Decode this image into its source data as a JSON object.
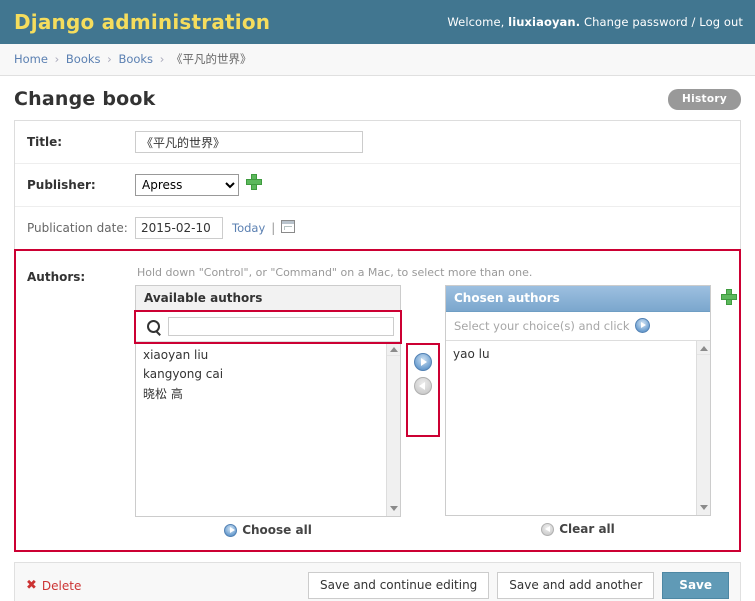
{
  "header": {
    "brand": "Django administration",
    "welcome_prefix": "Welcome,",
    "username": "liuxiaoyan.",
    "change_password": "Change password",
    "separator": "/",
    "logout": "Log out"
  },
  "breadcrumbs": {
    "items": [
      "Home",
      "Books",
      "Books"
    ],
    "current": "《平凡的世界》",
    "separator": "›"
  },
  "page": {
    "title": "Change book",
    "history_label": "History"
  },
  "form": {
    "title_label": "Title:",
    "title_value": "《平凡的世界》",
    "publisher_label": "Publisher:",
    "publisher_value": "Apress",
    "publisher_options": [
      "Apress"
    ],
    "add_publisher_icon": "add-plus-icon",
    "pubdate_label": "Publication date:",
    "pubdate_value": "2015-02-10",
    "today_label": "Today",
    "pipe": "|",
    "calendar_icon": "calendar-icon",
    "authors_label": "Authors:",
    "authors_help": "Hold down \"Control\", or \"Command\" on a Mac, to select more than one."
  },
  "selector": {
    "available_title": "Available authors",
    "search_icon": "search-icon",
    "search_value": "",
    "search_placeholder": "",
    "available_items": [
      "xiaoyan liu",
      "kangyong cai",
      "晓松 高"
    ],
    "choose_all_label": "Choose all",
    "chosen_title": "Chosen authors",
    "chosen_help": "Select your choice(s) and click",
    "chosen_help_icon": "arrow-right-circle-icon",
    "chosen_items": [
      "yao lu"
    ],
    "clear_all_label": "Clear all",
    "add_button_icon": "chooser-add-arrow-icon",
    "remove_button_icon": "chooser-remove-arrow-icon",
    "add_author_icon": "add-plus-icon"
  },
  "submit": {
    "delete_icon": "delete-x-icon",
    "delete_label": "Delete",
    "save_continue_label": "Save and continue editing",
    "save_add_another_label": "Save and add another",
    "save_label": "Save"
  },
  "colors": {
    "header_bg": "#417690",
    "brand_text": "#f5dd5d",
    "link_blue": "#5b80b2",
    "highlight_red": "#cc0033",
    "save_button": "#609ab6",
    "delete_red": "#cc3333",
    "chosen_header": "#7ba7cd",
    "add_green": "#5cb85c"
  }
}
